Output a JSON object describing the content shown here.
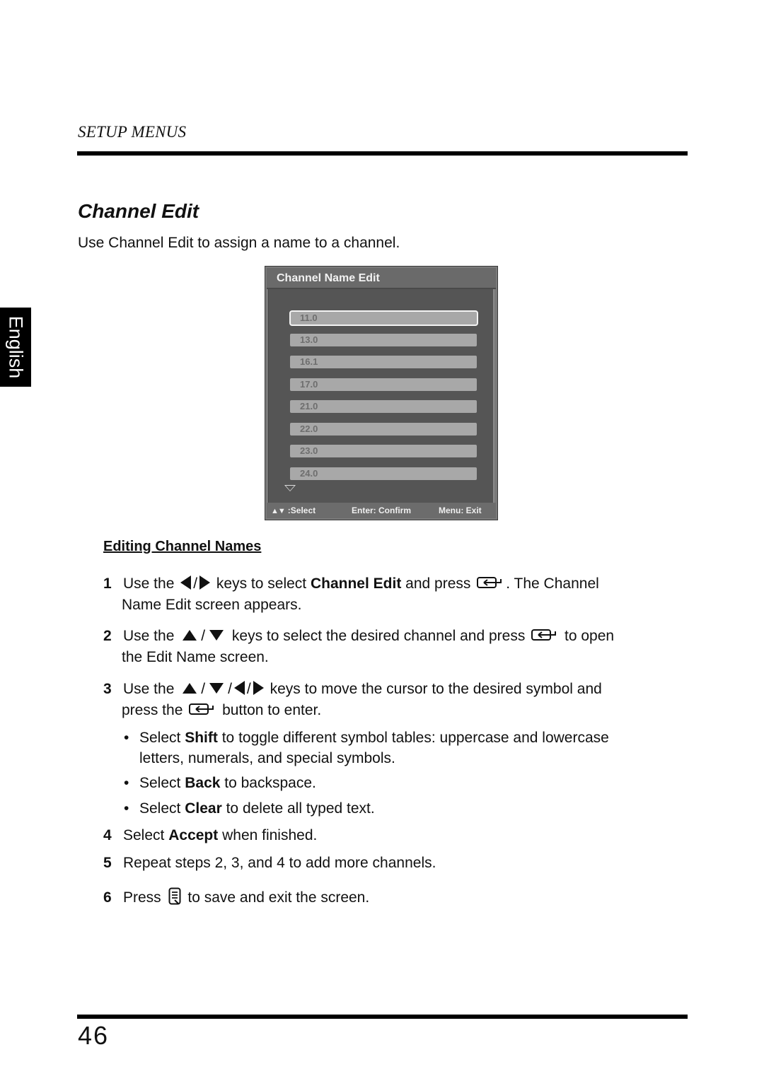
{
  "header": {
    "section": "SETUP MENUS"
  },
  "side_tab": {
    "label": "English"
  },
  "page": {
    "title": "Channel Edit",
    "intro": "Use Channel Edit to assign a name to a channel.",
    "number": "46"
  },
  "osd": {
    "title": "Channel Name Edit",
    "selected_index": 0,
    "channels": [
      "11.0",
      "13.0",
      "16.1",
      "17.0",
      "21.0",
      "22.0",
      "23.0",
      "24.0"
    ],
    "footer": {
      "select_label": ":Select",
      "confirm_label": "Enter: Confirm",
      "exit_label": "Menu: Exit"
    },
    "colors": {
      "frame": "#7a7a7a",
      "body": "#555555",
      "row": "#a8a8a8",
      "row_text": "#6e6e6e",
      "title_text": "#f2f2f2"
    }
  },
  "instructions": {
    "heading": "Editing Channel Names",
    "steps": [
      {
        "num": "1",
        "parts": {
          "a": "Use the",
          "b": "keys to select",
          "bold": "Channel Edit",
          "c": "and press",
          "d": ". The Channel",
          "e": "Name Edit screen appears."
        }
      },
      {
        "num": "2",
        "parts": {
          "a": "Use the",
          "b": "keys to select the desired channel and press",
          "c": "to open",
          "d": "the Edit Name screen."
        }
      },
      {
        "num": "3",
        "parts": {
          "a": "Use the",
          "b": "keys to move the cursor to the desired symbol and",
          "c": "press the",
          "d": "button to enter."
        }
      },
      {
        "num": "4",
        "parts": {
          "a": "Select",
          "bold": "Accept",
          "b": "when finished."
        }
      },
      {
        "num": "5",
        "parts": {
          "a": "Repeat steps 2, 3, and 4 to add more channels."
        }
      },
      {
        "num": "6",
        "parts": {
          "a": "Press",
          "b": "to save and exit the screen."
        }
      }
    ],
    "bullets": [
      {
        "a": "Select",
        "bold": "Shift",
        "b": "to toggle different symbol tables: uppercase and lowercase",
        "c": "letters, numerals, and special symbols."
      },
      {
        "a": "Select",
        "bold": "Back",
        "b": "to backspace."
      },
      {
        "a": "Select",
        "bold": "Clear",
        "b": "to delete all typed text."
      }
    ],
    "separator": "/",
    "bullet_char": "•"
  },
  "icons": {
    "left": "left-arrow-key",
    "right": "right-arrow-key",
    "up": "up-arrow-key",
    "down": "down-arrow-key",
    "enter": "enter-key",
    "menu": "menu-key"
  }
}
